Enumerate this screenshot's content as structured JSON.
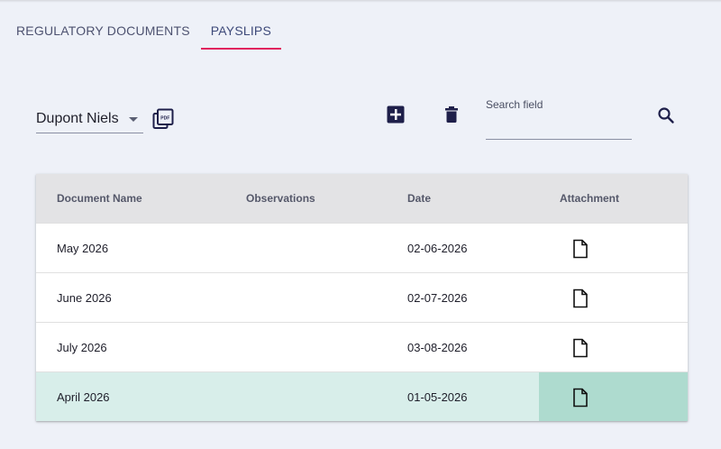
{
  "tabs": [
    {
      "label": "REGULATORY DOCUMENTS",
      "active": false
    },
    {
      "label": "PAYSLIPS",
      "active": true
    }
  ],
  "toolbar": {
    "employee_select": {
      "value": "Dupont Niels"
    },
    "search": {
      "label": "Search field",
      "value": "",
      "placeholder": ""
    },
    "icons": {
      "export_pdf": "pdf-icon",
      "add": "add-box-icon",
      "delete": "trash-icon",
      "search": "search-icon"
    }
  },
  "table": {
    "columns": [
      "Document Name",
      "Observations",
      "Date",
      "Attachment"
    ],
    "rows": [
      {
        "name": "May 2026",
        "observations": "",
        "date": "02-06-2026",
        "attachment": "file-icon",
        "selected": false
      },
      {
        "name": "June 2026",
        "observations": "",
        "date": "02-07-2026",
        "attachment": "file-icon",
        "selected": false
      },
      {
        "name": "July 2026",
        "observations": "",
        "date": "03-08-2026",
        "attachment": "file-icon",
        "selected": false
      },
      {
        "name": "April 2026",
        "observations": "",
        "date": "01-05-2026",
        "attachment": "file-icon",
        "selected": true
      }
    ]
  },
  "colors": {
    "background": "#eef1f8",
    "active_tab_indicator": "#e0245e",
    "header_background": "#e3e3e5",
    "selected_row": "#d8eeea",
    "selected_cell": "#aedbcf",
    "icon": "#1e1f4a"
  }
}
